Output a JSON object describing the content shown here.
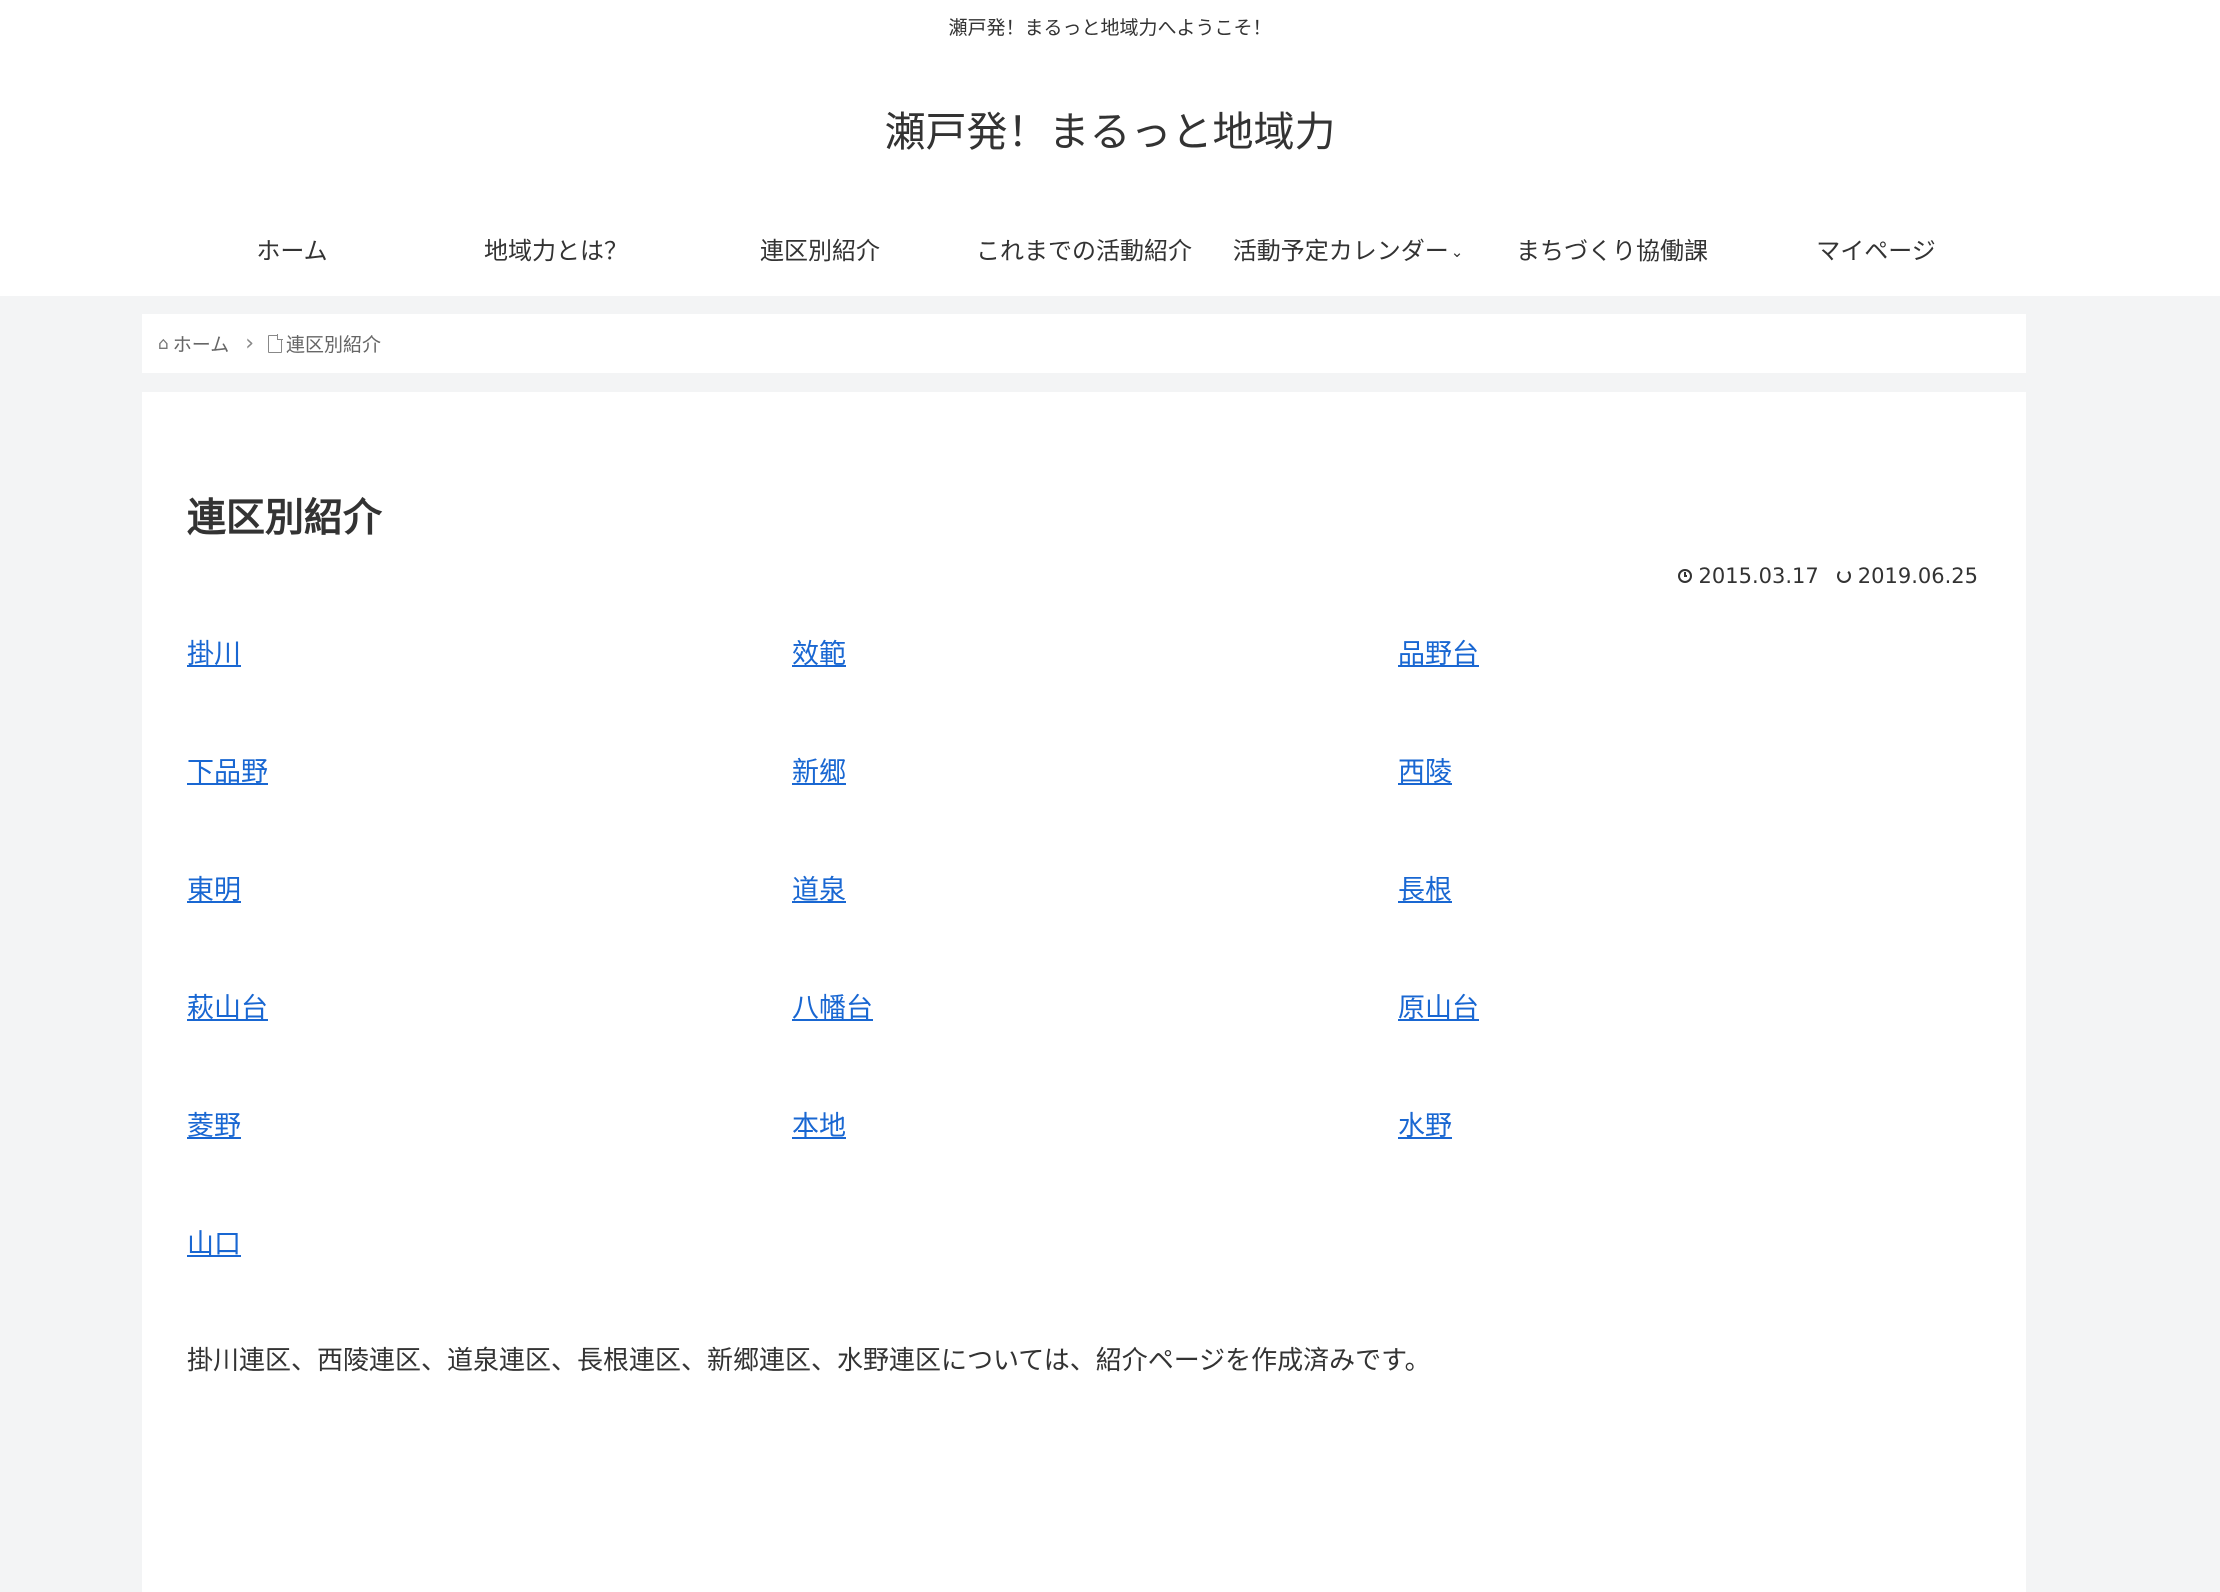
{
  "header": {
    "tagline": "瀬戸発！まるっと地域力へようこそ！",
    "site_title": "瀬戸発！まるっと地域力"
  },
  "nav": {
    "items": [
      {
        "label": "ホーム"
      },
      {
        "label": "地域力とは？"
      },
      {
        "label": "連区別紹介"
      },
      {
        "label": "これまでの活動紹介"
      },
      {
        "label": "活動予定カレンダー"
      },
      {
        "label": "まちづくり協働課"
      },
      {
        "label": "マイページ"
      }
    ]
  },
  "breadcrumb": {
    "home_label": "ホーム",
    "current_label": "連区別紹介",
    "home_icon": "home-icon",
    "page_icon": "file-icon"
  },
  "article": {
    "title": "連区別紹介",
    "posted_date": "2015.03.17",
    "updated_date": "2019.06.25",
    "links": [
      [
        "掛川",
        "效範",
        "品野台"
      ],
      [
        "下品野",
        "新郷",
        "西陵"
      ],
      [
        "東明",
        "道泉",
        "長根"
      ],
      [
        "萩山台",
        "八幡台",
        "原山台"
      ],
      [
        "菱野",
        "本地",
        "水野"
      ],
      [
        "山口"
      ]
    ],
    "note": "掛川連区、西陵連区、道泉連区、長根連区、新郷連区、水野連区については、紹介ページを作成済みです。"
  },
  "colors": {
    "link": "#1967d2",
    "background": "#f3f4f5",
    "text": "#333333"
  }
}
